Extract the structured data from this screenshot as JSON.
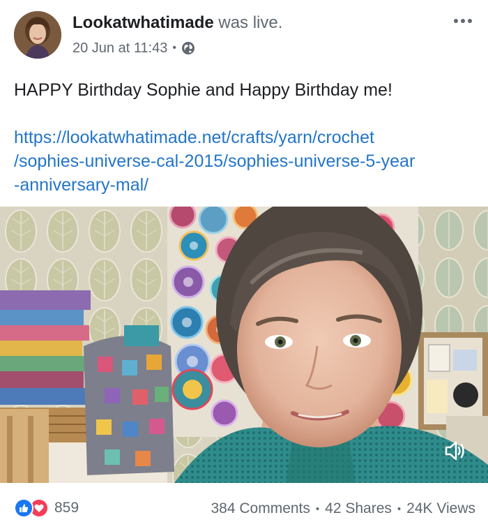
{
  "post": {
    "author_name": "Lookatwhatimade",
    "author_status": "was live.",
    "date": "20 Jun at 11:43",
    "meta_separator": "•",
    "text": "HAPPY Birthday Sophie and Happy Birthday me!",
    "link_lines": [
      "https://lookatwhatimade.net/crafts/yarn/crochet",
      "/sophies-universe-cal-2015/sophies-universe-5-year",
      "-anniversary-mal/"
    ]
  },
  "icons": {
    "privacy": "globe-icon",
    "menu": "more-options-icon",
    "sound": "speaker-muted-icon",
    "reaction_1": "like-icon",
    "reaction_2": "love-icon"
  },
  "footer": {
    "reaction_count": "859",
    "comments": "384 Comments",
    "shares": "42 Shares",
    "views": "24K Views",
    "separator": "•"
  },
  "colors": {
    "link": "#2375c9",
    "like": "#1877f2",
    "love": "#f33e58",
    "secondary_text": "#606770"
  }
}
